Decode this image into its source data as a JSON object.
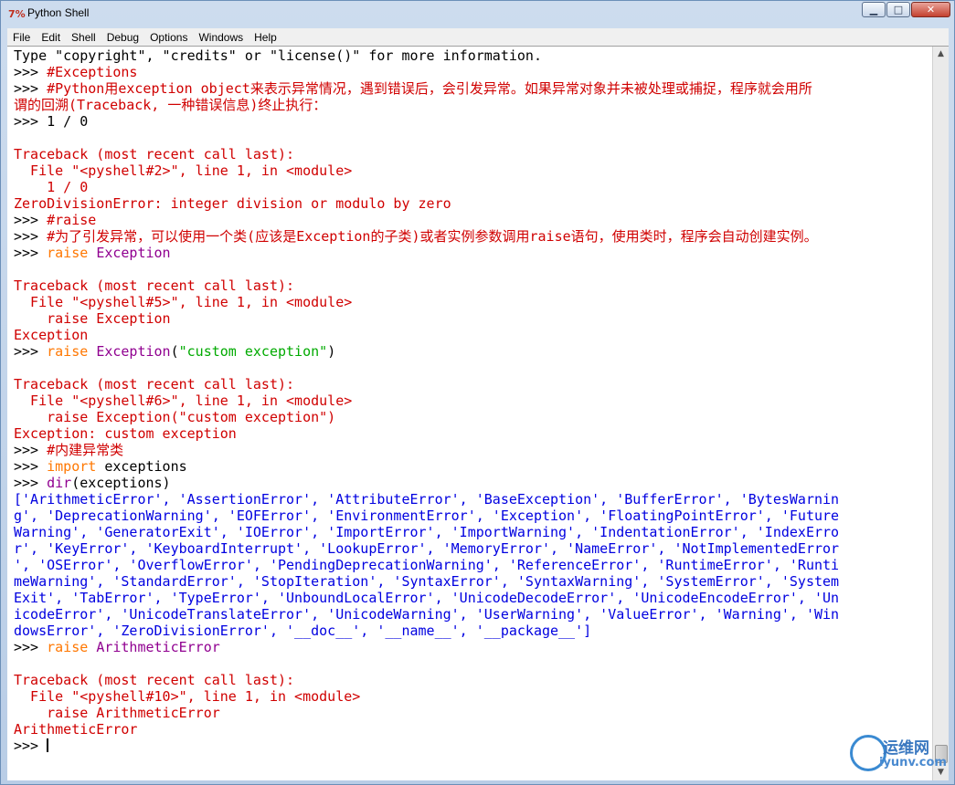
{
  "window": {
    "title": "Python Shell",
    "app_icon": "7%",
    "buttons": {
      "minimize": "▁",
      "maximize": "□",
      "close": "✕"
    }
  },
  "menu": [
    "File",
    "Edit",
    "Shell",
    "Debug",
    "Options",
    "Windows",
    "Help"
  ],
  "shell": {
    "lines": [
      [
        {
          "t": "Type \"copyright\", \"credits\" or \"license()\" for more information.",
          "c": ""
        }
      ],
      [
        {
          "t": ">>> ",
          "c": ""
        },
        {
          "t": "#Exceptions",
          "c": "red"
        }
      ],
      [
        {
          "t": ">>> ",
          "c": ""
        },
        {
          "t": "#Python用exception object来表示异常情况，遇到错误后，会引发异常。如果异常对象并未被处理或捕捉，程序就会用所",
          "c": "red"
        }
      ],
      [
        {
          "t": "谓的回溯(Traceback, 一种错误信息)终止执行：",
          "c": "red"
        }
      ],
      [
        {
          "t": ">>> 1 / 0",
          "c": ""
        }
      ],
      [
        {
          "t": "",
          "c": ""
        }
      ],
      [
        {
          "t": "Traceback (most recent call last):",
          "c": "red"
        }
      ],
      [
        {
          "t": "  File \"<pyshell#2>\", line 1, in <module>",
          "c": "red"
        }
      ],
      [
        {
          "t": "    1 / 0",
          "c": "red"
        }
      ],
      [
        {
          "t": "ZeroDivisionError: integer division or modulo by zero",
          "c": "red"
        }
      ],
      [
        {
          "t": ">>> ",
          "c": ""
        },
        {
          "t": "#raise",
          "c": "red"
        }
      ],
      [
        {
          "t": ">>> ",
          "c": ""
        },
        {
          "t": "#为了引发异常，可以使用一个类(应该是Exception的子类)或者实例参数调用raise语句，使用类时，程序会自动创建实例。",
          "c": "red"
        }
      ],
      [
        {
          "t": ">>> ",
          "c": ""
        },
        {
          "t": "raise",
          "c": "kw"
        },
        {
          "t": " ",
          "c": ""
        },
        {
          "t": "Exception",
          "c": "bi"
        }
      ],
      [
        {
          "t": "",
          "c": ""
        }
      ],
      [
        {
          "t": "Traceback (most recent call last):",
          "c": "red"
        }
      ],
      [
        {
          "t": "  File \"<pyshell#5>\", line 1, in <module>",
          "c": "red"
        }
      ],
      [
        {
          "t": "    raise Exception",
          "c": "red"
        }
      ],
      [
        {
          "t": "Exception",
          "c": "red"
        }
      ],
      [
        {
          "t": ">>> ",
          "c": ""
        },
        {
          "t": "raise",
          "c": "kw"
        },
        {
          "t": " ",
          "c": ""
        },
        {
          "t": "Exception",
          "c": "bi"
        },
        {
          "t": "(",
          "c": ""
        },
        {
          "t": "\"custom exception\"",
          "c": "str"
        },
        {
          "t": ")",
          "c": ""
        }
      ],
      [
        {
          "t": "",
          "c": ""
        }
      ],
      [
        {
          "t": "Traceback (most recent call last):",
          "c": "red"
        }
      ],
      [
        {
          "t": "  File \"<pyshell#6>\", line 1, in <module>",
          "c": "red"
        }
      ],
      [
        {
          "t": "    raise Exception(\"custom exception\")",
          "c": "red"
        }
      ],
      [
        {
          "t": "Exception: custom exception",
          "c": "red"
        }
      ],
      [
        {
          "t": ">>> ",
          "c": ""
        },
        {
          "t": "#内建异常类",
          "c": "red"
        }
      ],
      [
        {
          "t": ">>> ",
          "c": ""
        },
        {
          "t": "import",
          "c": "kw"
        },
        {
          "t": " exceptions",
          "c": ""
        }
      ],
      [
        {
          "t": ">>> ",
          "c": ""
        },
        {
          "t": "dir",
          "c": "bi"
        },
        {
          "t": "(exceptions)",
          "c": ""
        }
      ],
      [
        {
          "t": "['ArithmeticError', 'AssertionError', 'AttributeError', 'BaseException', 'BufferError', 'BytesWarnin",
          "c": "blue"
        }
      ],
      [
        {
          "t": "g', 'DeprecationWarning', 'EOFError', 'EnvironmentError', 'Exception', 'FloatingPointError', 'Future",
          "c": "blue"
        }
      ],
      [
        {
          "t": "Warning', 'GeneratorExit', 'IOError', 'ImportError', 'ImportWarning', 'IndentationError', 'IndexErro",
          "c": "blue"
        }
      ],
      [
        {
          "t": "r', 'KeyError', 'KeyboardInterrupt', 'LookupError', 'MemoryError', 'NameError', 'NotImplementedError",
          "c": "blue"
        }
      ],
      [
        {
          "t": "', 'OSError', 'OverflowError', 'PendingDeprecationWarning', 'ReferenceError', 'RuntimeError', 'Runti",
          "c": "blue"
        }
      ],
      [
        {
          "t": "meWarning', 'StandardError', 'StopIteration', 'SyntaxError', 'SyntaxWarning', 'SystemError', 'System",
          "c": "blue"
        }
      ],
      [
        {
          "t": "Exit', 'TabError', 'TypeError', 'UnboundLocalError', 'UnicodeDecodeError', 'UnicodeEncodeError', 'Un",
          "c": "blue"
        }
      ],
      [
        {
          "t": "icodeError', 'UnicodeTranslateError', 'UnicodeWarning', 'UserWarning', 'ValueError', 'Warning', 'Win",
          "c": "blue"
        }
      ],
      [
        {
          "t": "dowsError', 'ZeroDivisionError', '__doc__', '__name__', '__package__']",
          "c": "blue"
        }
      ],
      [
        {
          "t": ">>> ",
          "c": ""
        },
        {
          "t": "raise",
          "c": "kw"
        },
        {
          "t": " ",
          "c": ""
        },
        {
          "t": "ArithmeticError",
          "c": "bi"
        }
      ],
      [
        {
          "t": "",
          "c": ""
        }
      ],
      [
        {
          "t": "Traceback (most recent call last):",
          "c": "red"
        }
      ],
      [
        {
          "t": "  File \"<pyshell#10>\", line 1, in <module>",
          "c": "red"
        }
      ],
      [
        {
          "t": "    raise ArithmeticError",
          "c": "red"
        }
      ],
      [
        {
          "t": "ArithmeticError",
          "c": "red"
        }
      ],
      [
        {
          "t": ">>> ",
          "c": ""
        }
      ]
    ]
  },
  "watermark": {
    "line1": "运维网",
    "line2": "iyunv.com"
  },
  "colors": {
    "error": "#d00000",
    "keyword": "#ff7700",
    "builtin": "#900090",
    "string": "#00aa00",
    "output": "#0000e0"
  }
}
